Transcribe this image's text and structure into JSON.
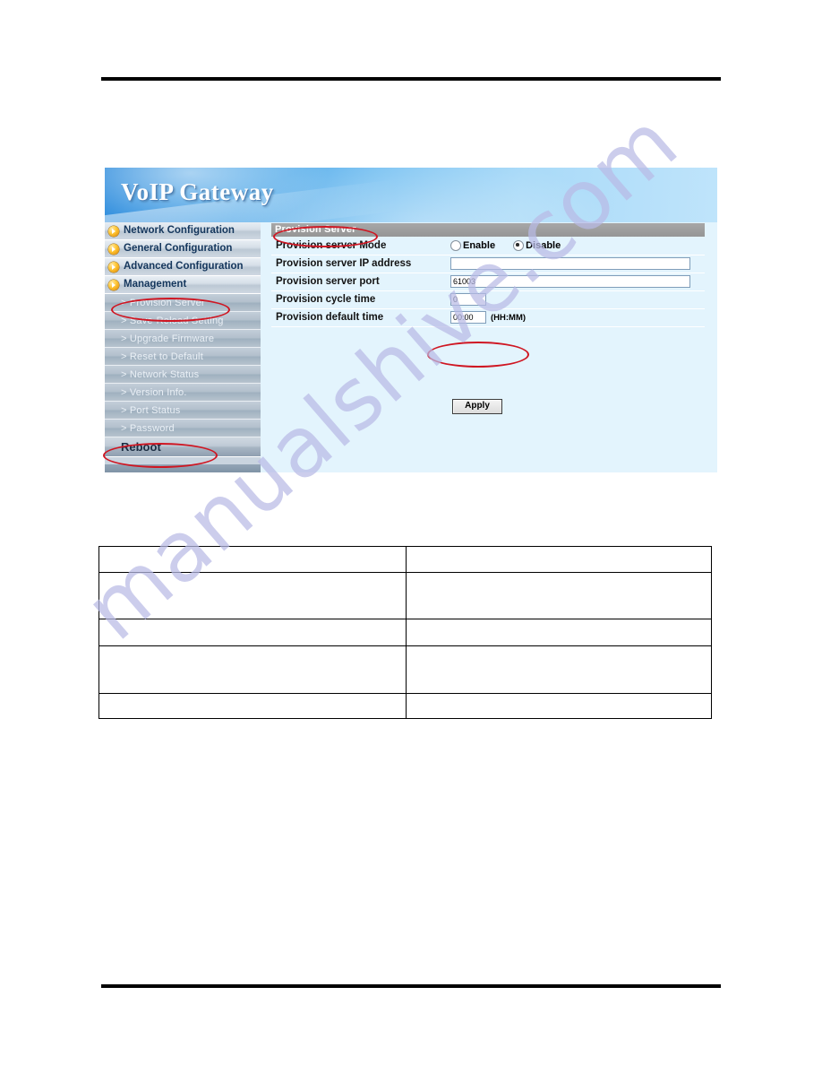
{
  "page": {
    "watermark": "manualshive.com",
    "rules": [
      "top-rule",
      "bottom-rule"
    ]
  },
  "banner": {
    "title": "VoIP  Gateway"
  },
  "sidebar": {
    "main_items": [
      {
        "label": "Network Configuration",
        "icon": "orange-arrow-icon"
      },
      {
        "label": "General Configuration",
        "icon": "orange-arrow-icon"
      },
      {
        "label": "Advanced Configuration",
        "icon": "orange-arrow-icon"
      },
      {
        "label": "Management",
        "icon": "orange-arrow-icon"
      }
    ],
    "sub_items": [
      {
        "label": "> Provision Server"
      },
      {
        "label": "> Save-Reload Setting"
      },
      {
        "label": "> Upgrade Firmware"
      },
      {
        "label": "> Reset to Default"
      },
      {
        "label": "> Network Status"
      },
      {
        "label": "> Version Info."
      },
      {
        "label": "> Port Status"
      },
      {
        "label": "> Password"
      }
    ],
    "reboot": {
      "label": "Reboot"
    }
  },
  "panel": {
    "header": "Provision Server",
    "rows": [
      {
        "label": "Provision server Mode",
        "type": "radio",
        "options": [
          {
            "label": "Enable",
            "selected": false
          },
          {
            "label": "Disable",
            "selected": true
          }
        ]
      },
      {
        "label": "Provision server IP address",
        "type": "text",
        "value": "",
        "size": "wide"
      },
      {
        "label": "Provision server port",
        "type": "text",
        "value": "61003",
        "size": "wide"
      },
      {
        "label": "Provision cycle time",
        "type": "text",
        "value": "0",
        "size": "small"
      },
      {
        "label": "Provision default time",
        "type": "text",
        "value": "00:00",
        "size": "small",
        "hint": "(HH:MM)"
      }
    ],
    "apply_label": "Apply"
  },
  "annotations": {
    "color": "#cf1622",
    "ellipses": [
      "provision-server-panel-header",
      "provision-server-sidebar-item",
      "reboot-sidebar-item",
      "apply-button"
    ]
  },
  "spec_table": {
    "columns": [
      "",
      ""
    ],
    "rows": [
      {
        "cells": [
          "",
          ""
        ]
      },
      {
        "cells": [
          "",
          ""
        ]
      },
      {
        "cells": [
          "",
          ""
        ]
      },
      {
        "cells": [
          "",
          ""
        ]
      },
      {
        "cells": [
          "",
          ""
        ]
      }
    ]
  }
}
